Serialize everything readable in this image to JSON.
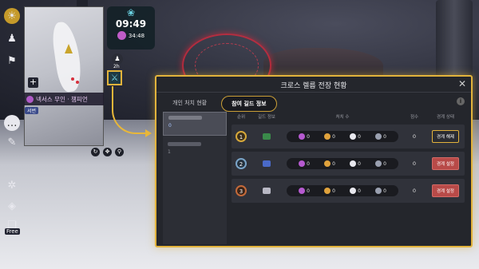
{
  "clock": {
    "time": "09:49",
    "remaining": "34:48"
  },
  "clock_under_label": "2h",
  "zone": {
    "name": "넥서스 무인 · 챔피언",
    "channel": "서번"
  },
  "sidebar": {
    "items": [
      {
        "icon": "sun-emblem-icon"
      },
      {
        "icon": "character-icon"
      },
      {
        "icon": "party-icon"
      },
      {
        "icon": "chat-icon"
      },
      {
        "icon": "pen-icon"
      },
      {
        "icon": "settings-icon"
      },
      {
        "icon": "diamond-icon"
      },
      {
        "icon": "gift-icon"
      }
    ],
    "free_label": "Free"
  },
  "panel": {
    "title": "크로스 렐름 전장 현황",
    "close": "✕",
    "tabs": [
      {
        "label": "개인 처치 현황",
        "active": false
      },
      {
        "label": "참여 길드 정보",
        "active": true
      }
    ],
    "info": "i",
    "guild_list": [
      {
        "sub": "0",
        "selected": true
      },
      {
        "sub": "1",
        "selected": false
      }
    ],
    "table": {
      "headers": {
        "rank": "순위",
        "guild": "길드 정보",
        "kills": "처치 수",
        "score": "점수",
        "state": "경계 상태"
      },
      "rows": [
        {
          "rank": "1",
          "emblem_color": "#3a8a4a",
          "kills": [
            "0",
            "0",
            "0",
            "0"
          ],
          "score": "0",
          "state": "경계 해제",
          "state_type": "release"
        },
        {
          "rank": "2",
          "emblem_color": "#4a6ac8",
          "kills": [
            "0",
            "0",
            "0",
            "0"
          ],
          "score": "0",
          "state": "경계 설정",
          "state_type": "set"
        },
        {
          "rank": "3",
          "emblem_color": "#b8b8c4",
          "kills": [
            "0",
            "0",
            "0",
            "0"
          ],
          "score": "0",
          "state": "경계 설정",
          "state_type": "set"
        }
      ]
    },
    "kill_icon_colors": [
      "#b65ad0",
      "#e0a23c",
      "#e8e8ee",
      "#9aa0b0"
    ]
  }
}
